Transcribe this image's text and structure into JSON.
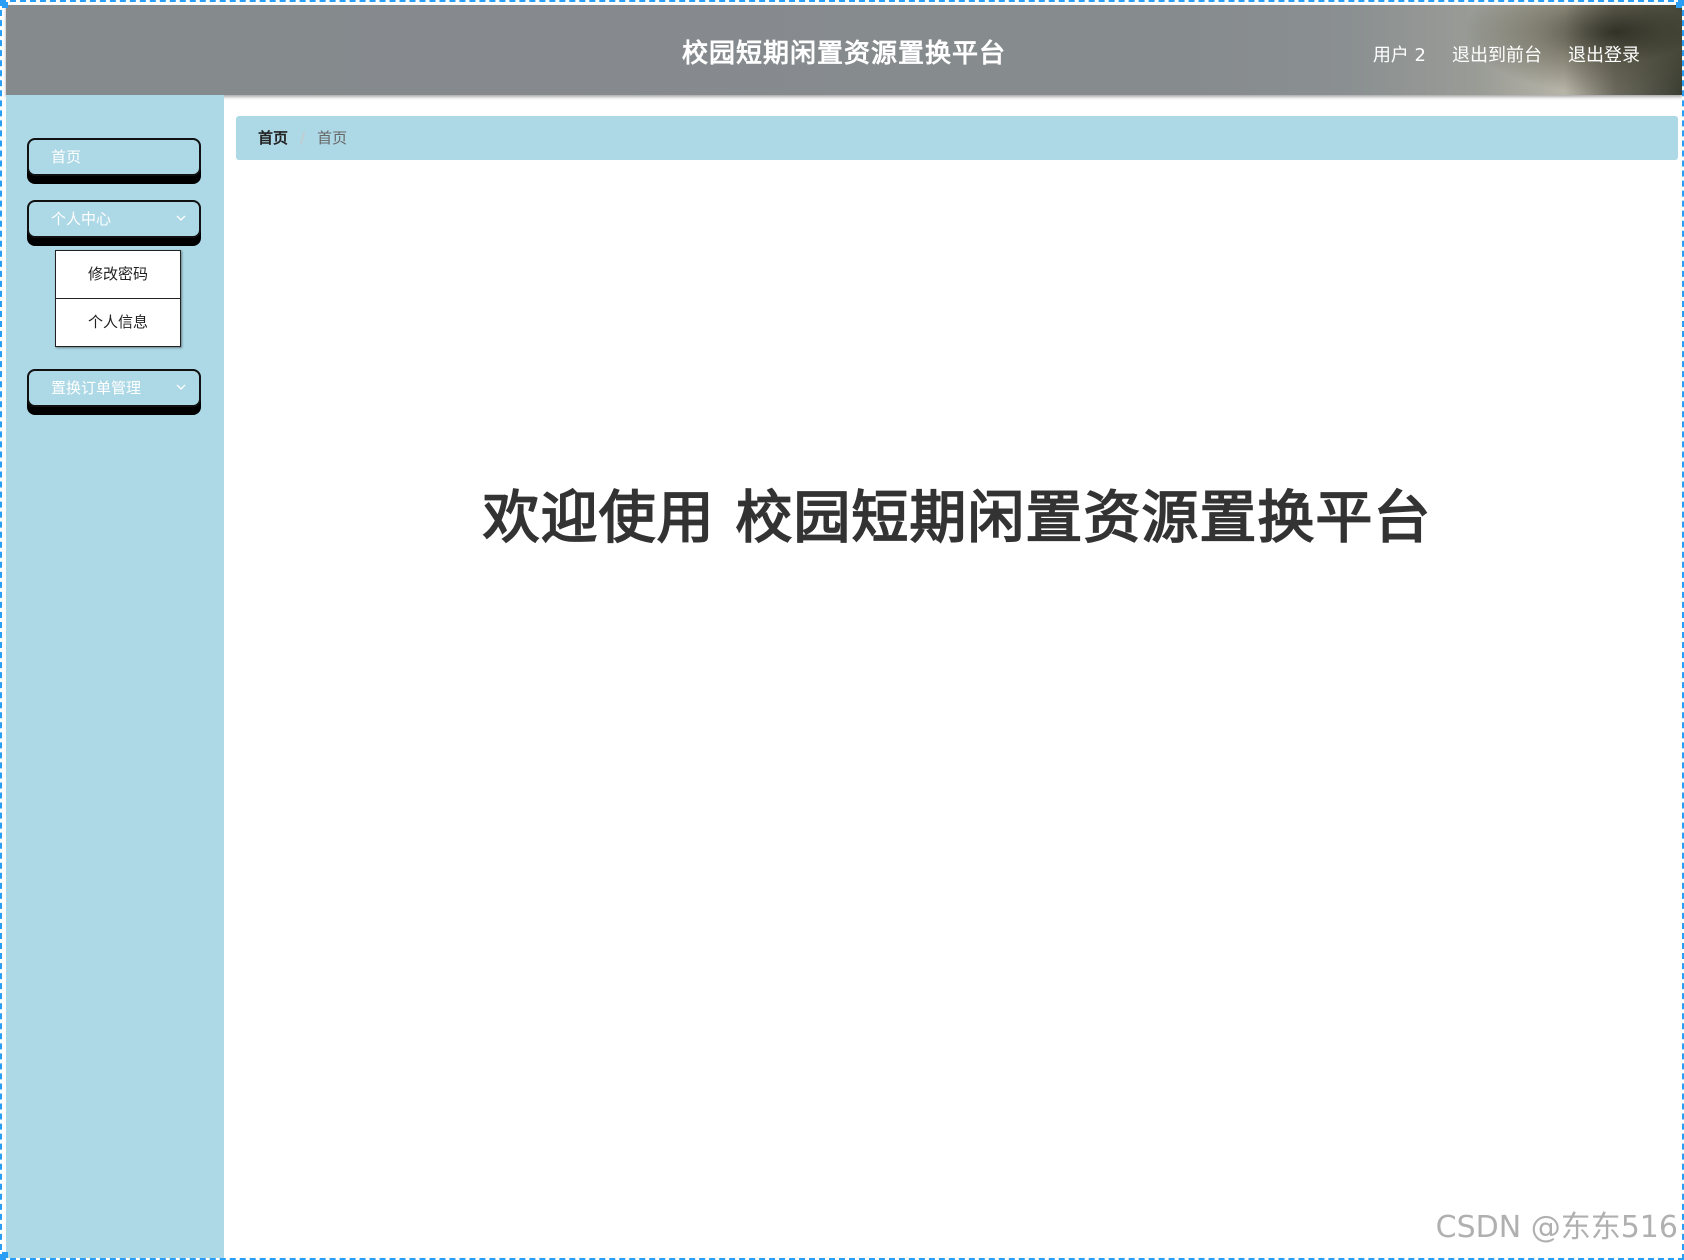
{
  "header": {
    "title": "校园短期闲置资源置换平台",
    "user": "用户 2",
    "back_to_front": "退出到前台",
    "logout": "退出登录"
  },
  "sidebar": {
    "items": [
      {
        "label": "首页"
      },
      {
        "label": "个人中心",
        "expanded": true,
        "children": [
          "修改密码",
          "个人信息"
        ]
      },
      {
        "label": "置换订单管理",
        "expanded": false
      }
    ]
  },
  "breadcrumb": {
    "home": "首页",
    "separator": "/",
    "current": "首页"
  },
  "main": {
    "welcome": "欢迎使用 校园短期闲置资源置换平台"
  },
  "watermark": "CSDN @东东516",
  "colors": {
    "sidebar_bg": "#add8e6",
    "header_bg": "#868b8e",
    "accent": "#2a9df4"
  }
}
